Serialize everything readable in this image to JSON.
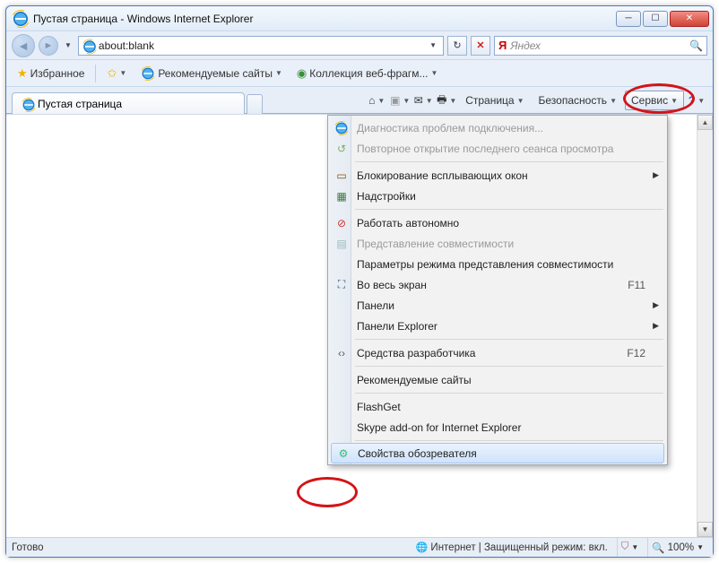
{
  "window": {
    "title": "Пустая страница - Windows Internet Explorer"
  },
  "address": {
    "url": "about:blank"
  },
  "search": {
    "provider": "Яндех",
    "providerInitial": "Я"
  },
  "favbar": {
    "favorites": "Избранное",
    "suggested": "Рекомендуемые сайты",
    "webslice": "Коллекция веб-фрагм..."
  },
  "tab": {
    "title": "Пустая страница"
  },
  "toolbar": {
    "page": "Страница",
    "safety": "Безопасность",
    "tools": "Сервис"
  },
  "menu": {
    "diag": "Диагностика проблем подключения...",
    "reopen": "Повторное открытие последнего сеанса просмотра",
    "popup": "Блокирование всплывающих окон",
    "addons": "Надстройки",
    "offline": "Работать автономно",
    "compatview": "Представление совместимости",
    "compatsettings": "Параметры режима представления совместимости",
    "fullscreen": "Во весь экран",
    "fullscreen_key": "F11",
    "panels": "Панели",
    "explorerbars": "Панели Explorer",
    "devtools": "Средства разработчика",
    "devtools_key": "F12",
    "recsites": "Рекомендуемые сайты",
    "flashget": "FlashGet",
    "skype": "Skype add-on for Internet Explorer",
    "inetopts": "Свойства обозревателя"
  },
  "status": {
    "ready": "Готово",
    "zone": "Интернет | Защищенный режим: вкл.",
    "zoom": "100%"
  }
}
